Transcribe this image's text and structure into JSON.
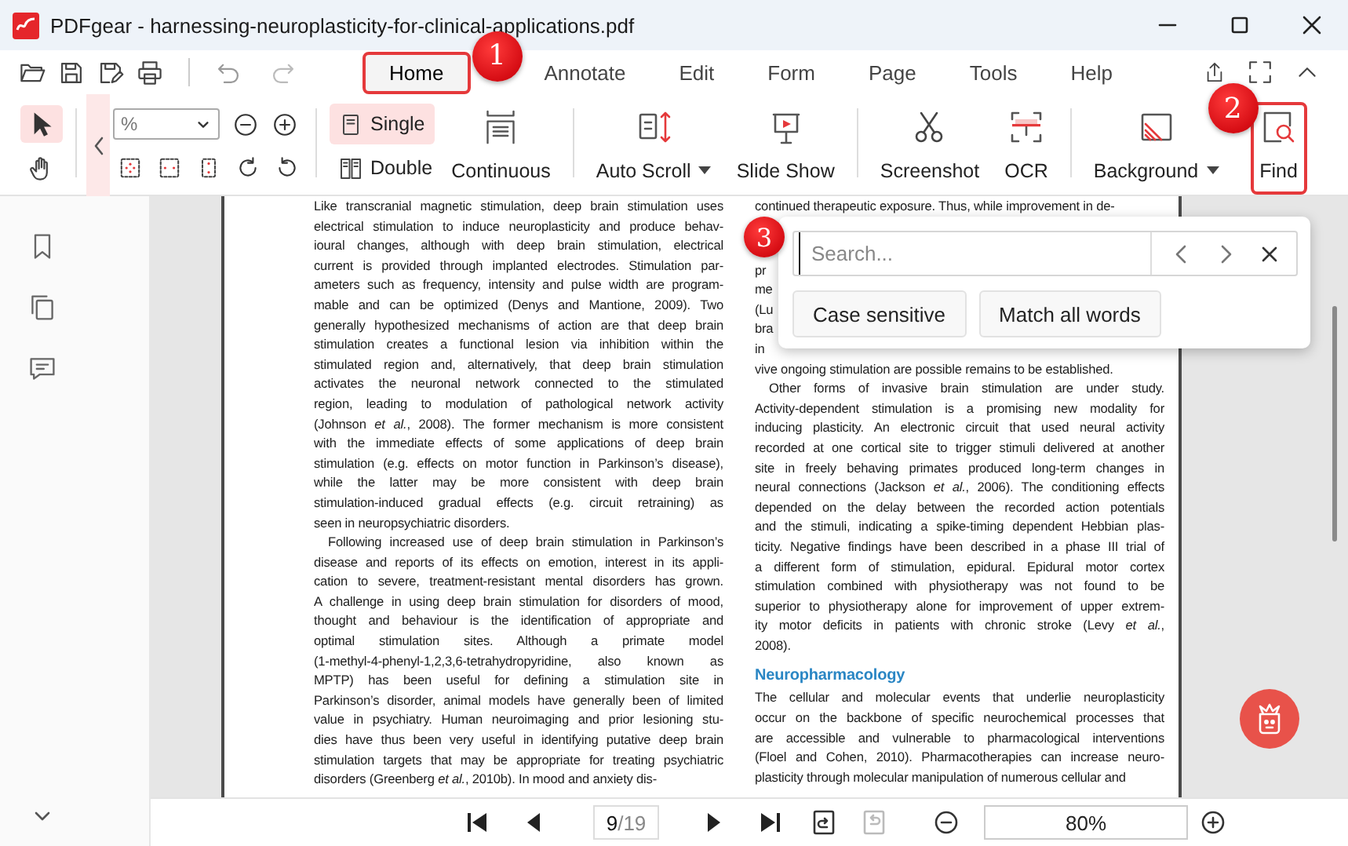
{
  "window": {
    "title": "PDFgear - harnessing-neuroplasticity-for-clinical-applications.pdf"
  },
  "menu_tabs": [
    {
      "label": "Home",
      "selected": true,
      "highlighted": true,
      "callout": "1"
    },
    {
      "label": "Annotate",
      "selected": false,
      "highlighted": false
    },
    {
      "label": "Edit",
      "selected": false,
      "highlighted": false
    },
    {
      "label": "Form",
      "selected": false,
      "highlighted": false
    },
    {
      "label": "Page",
      "selected": false,
      "highlighted": false
    },
    {
      "label": "Tools",
      "selected": false,
      "highlighted": false
    },
    {
      "label": "Help",
      "selected": false,
      "highlighted": false
    }
  ],
  "pointer_tools": [
    {
      "selected": true
    },
    {
      "selected": false
    }
  ],
  "zoom_box": {
    "value": "%"
  },
  "view_modes": [
    {
      "label": "Single",
      "selected": true
    },
    {
      "label": "Double",
      "selected": false
    },
    {
      "label": "Continuous",
      "selected": false
    }
  ],
  "tools": [
    {
      "label": "Auto Scroll",
      "dropdown": true,
      "highlighted": false
    },
    {
      "label": "Slide Show",
      "dropdown": false,
      "highlighted": false
    },
    {
      "label": "Screenshot",
      "dropdown": false,
      "highlighted": false
    },
    {
      "label": "OCR",
      "dropdown": false,
      "highlighted": false
    },
    {
      "label": "Background",
      "dropdown": true,
      "highlighted": false
    },
    {
      "label": "Find",
      "dropdown": false,
      "highlighted": true,
      "callout": "2"
    }
  ],
  "document": {
    "columns": [
      {
        "blocks": [
          {
            "kind": "paragraph",
            "indent": false,
            "lines": [
              "Like transcranial magnetic stimulation, deep brain stimulation uses",
              "electrical stimulation to induce neuroplasticity and produce behav-",
              "ioural changes, although with deep brain stimulation, electrical",
              "current is provided through implanted electrodes. Stimulation par-",
              "ameters such as frequency, intensity and pulse width are program-",
              "mable and can be optimized (Denys and Mantione, 2009). Two",
              "generally hypothesized mechanisms of action are that deep brain",
              "stimulation creates a functional lesion via inhibition within the",
              "stimulated region and, alternatively, that deep brain stimulation",
              "activates the neuronal network connected to the stimulated",
              "region, leading to modulation of pathological network activity",
              "(Johnson *et al.*, 2008). The former mechanism is more consistent",
              "with the immediate effects of some applications of deep brain",
              "stimulation (e.g. effects on motor function in Parkinson’s disease),",
              "while the latter may be more consistent with deep brain",
              "stimulation-induced gradual effects (e.g. circuit retraining) as",
              "seen in neuropsychiatric disorders."
            ]
          },
          {
            "kind": "paragraph",
            "indent": true,
            "lines": [
              "Following increased use of deep brain stimulation in Parkinson’s",
              "disease and reports of its effects on emotion, interest in its appli-",
              "cation to severe, treatment-resistant mental disorders has grown.",
              "A challenge in using deep brain stimulation for disorders of mood,",
              "thought and behaviour is the identification of appropriate and",
              "optimal stimulation sites. Although a primate model",
              "(1-methyl-4-phenyl-1,2,3,6-tetrahydropyridine, also known as",
              "MPTP) has been useful for defining a stimulation site in",
              "Parkinson’s disorder, animal models have generally been of limited",
              "value in psychiatry. Human neuroimaging and prior lesioning stu-",
              "dies have thus been very useful in identifying putative deep brain",
              "stimulation targets that may be appropriate for treating psychiatric",
              "disorders (Greenberg *et al.*, 2010b). In mood and anxiety dis-"
            ]
          }
        ]
      },
      {
        "blocks": [
          {
            "kind": "paragraph",
            "indent": false,
            "lines": [
              "continued therapeutic exposure. Thus, while improvement in de-"
            ]
          },
          {
            "kind": "covered",
            "lines": [
              "pr",
              "me",
              "(Lu",
              "bra",
              "in"
            ]
          },
          {
            "kind": "paragraph",
            "indent": false,
            "lines": [
              "vive ongoing stimulation are possible remains to be established."
            ]
          },
          {
            "kind": "paragraph",
            "indent": true,
            "lines": [
              "Other forms of invasive brain stimulation are under study.",
              "Activity-dependent stimulation is a promising new modality for",
              "inducing plasticity. An electronic circuit that used neural activity",
              "recorded at one cortical site to trigger stimuli delivered at another",
              "site in freely behaving primates produced long-term changes in",
              "neural connections (Jackson *et al.*, 2006). The conditioning effects",
              "depended on the delay between the recorded action potentials",
              "and the stimuli, indicating a spike-timing dependent Hebbian plas-",
              "ticity. Negative findings have been described in a phase III trial of",
              "a different form of stimulation, epidural. Epidural motor cortex",
              "stimulation combined with physiotherapy was not found to be",
              "superior to physiotherapy alone for improvement of upper extrem-",
              "ity motor deficits in patients with chronic stroke (Levy *et al.*,",
              "2008)."
            ]
          },
          {
            "kind": "heading",
            "text": "Neuropharmacology"
          },
          {
            "kind": "paragraph",
            "indent": false,
            "lines": [
              "The cellular and molecular events that underlie neuroplasticity",
              "occur on the backbone of specific neurochemical processes that",
              "are accessible and vulnerable to pharmacological interventions",
              "(Floel and Cohen, 2010). Pharmacotherapies can increase neuro-",
              "plasticity through molecular manipulation of numerous cellular and"
            ]
          }
        ]
      }
    ]
  },
  "find_popover": {
    "placeholder": "Search...",
    "options": [
      {
        "label": "Case sensitive"
      },
      {
        "label": "Match all words"
      }
    ],
    "callout": "3"
  },
  "page_nav": {
    "page": "9",
    "page_count": "/19",
    "zoom": "80%"
  }
}
